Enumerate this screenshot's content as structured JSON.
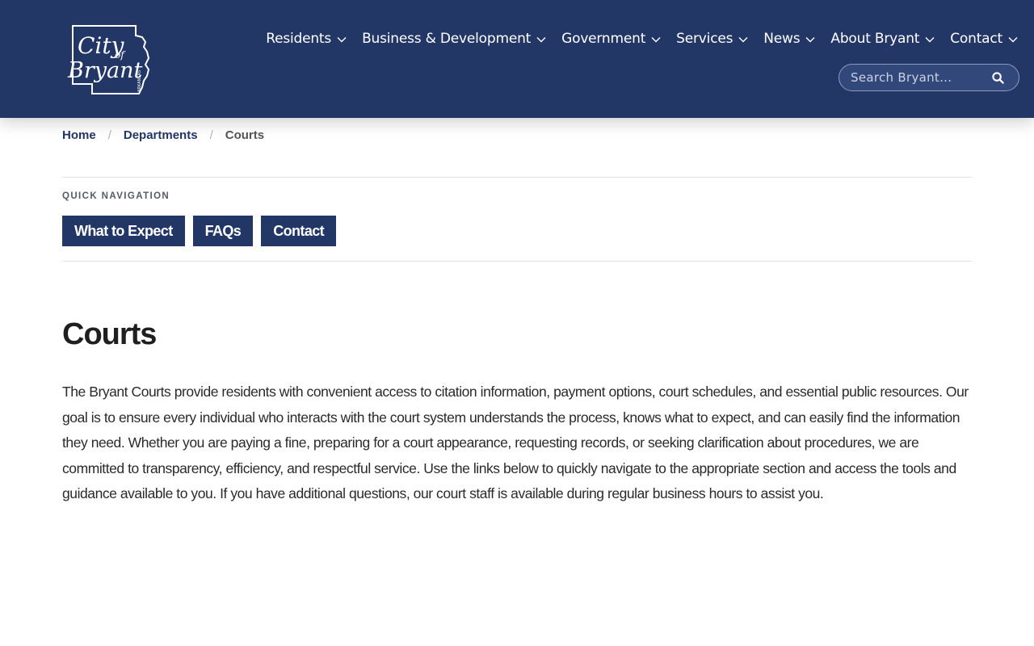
{
  "header": {
    "logo_text": {
      "city": "City",
      "of": "of",
      "bryant": "Bryant",
      "state": "ARKANSAS"
    },
    "nav": [
      {
        "label": "Residents"
      },
      {
        "label": "Business & Development"
      },
      {
        "label": "Government"
      },
      {
        "label": "Services"
      },
      {
        "label": "News"
      },
      {
        "label": "About Bryant"
      },
      {
        "label": "Contact"
      }
    ],
    "search": {
      "placeholder": "Search Bryant..."
    }
  },
  "breadcrumb": {
    "home": "Home",
    "departments": "Departments",
    "current": "Courts",
    "separator": "/"
  },
  "quick_nav": {
    "label": "QUICK NAVIGATION",
    "buttons": [
      "What to Expect",
      "FAQs",
      "Contact"
    ]
  },
  "main": {
    "title": "Courts",
    "intro": "The Bryant Courts provide residents with convenient access to citation information, payment options, court schedules, and essential public resources. Our goal is to ensure every individual who interacts with the court system understands the process, knows what to expect, and can easily find the information they need. Whether you are paying a fine, preparing for a court appearance, requesting records, or seeking clarification about procedures, we are committed to transparency, efficiency, and respectful service. Use the links below to quickly navigate to the appropriate section and access the tools and guidance available to you. If you have additional questions, our court staff is available during regular business hours to assist you."
  },
  "colors": {
    "brand_navy": "#233766",
    "text": "#1f1f1f",
    "divider": "#e3e3e3"
  },
  "icons": {
    "nav_dropdown": "chevron-down-icon",
    "search": "search-icon",
    "logo": "city-of-bryant-logo"
  }
}
